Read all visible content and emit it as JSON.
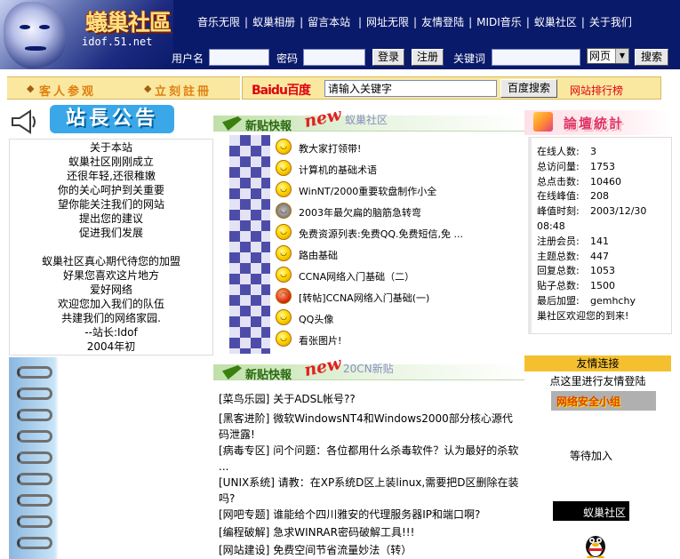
{
  "header": {
    "logo_text": "蟻巢社區",
    "logo_domain": "idof.51.net",
    "nav": [
      "音乐无限",
      "蚁巢相册",
      "留言本站",
      "网址无限",
      "友情登陆",
      "MIDI音乐",
      "蚁巢社区",
      "关于我们"
    ],
    "login": {
      "username_label": "用户名",
      "password_label": "密码",
      "login_button": "登录",
      "register_button": "注册",
      "keyword_label": "关键词",
      "search_scope": "网页",
      "search_button": "搜索"
    }
  },
  "band": {
    "guest_link": "客人参观",
    "register_link": "立刻註冊",
    "baidu_logo": "Baidu百度",
    "baidu_input_value": "请输入关键字",
    "baidu_button": "百度搜索",
    "rank_link": "网站排行榜"
  },
  "notice": {
    "title": "站長公告",
    "lines": [
      "关于本站",
      "蚁巢社区刚刚成立",
      "还很年轻,还很稚嫩",
      "你的关心呵护到关重要",
      "望你能关注我们的网站",
      "提出您的建议",
      "促进我们发展",
      "",
      "蚁巢社区真心期代待您的加盟",
      "好果您喜欢这片地方",
      "爱好网络",
      "欢迎您加入我们的队伍",
      "共建我们的网络家园.",
      "--站长:Idof",
      "2004年初"
    ]
  },
  "section1": {
    "title": "新贴快報",
    "badge": "new",
    "subtitle": "蚁巢社区",
    "posts": [
      "教大家打领带!",
      "计算机的基础术语",
      "WinNT/2000重要软盘制作小全",
      "2003年最欠扁的脑筋急转弯",
      "免费资源列表:免费QQ.免费短信,免 ...",
      "路由基础",
      "CCNA网络入门基础（二）",
      "[转帖]CCNA网络入门基础(一)",
      "QQ头像",
      "看张图片!"
    ]
  },
  "section2": {
    "title": "新贴快報",
    "badge": "new",
    "subtitle": "20CN新贴",
    "items": [
      {
        "tag": "[菜鸟乐园]",
        "text": "关于ADSL帐号??"
      },
      {
        "tag": "[黑客进阶]",
        "text": "微软WindowsNT4和Windows2000部分核心源代码泄露!"
      },
      {
        "tag": "[病毒专区]",
        "text": "问个问题：各位都用什么杀毒软件？认为最好的杀软 ..."
      },
      {
        "tag": "[UNIX系统]",
        "text": "请教：在XP系统D区上装linux,需要把D区删除在装吗?"
      },
      {
        "tag": "[网吧专题]",
        "text": "谁能给个四川雅安的代理服务器IP和端口啊?"
      },
      {
        "tag": "[编程破解]",
        "text": "急求WINRAR密码破解工具!!!"
      },
      {
        "tag": "[网站建设]",
        "text": "免费空间节省流量妙法（转）"
      }
    ]
  },
  "stats": {
    "title": "論壇統計",
    "rows": [
      {
        "k": "在线人数:",
        "v": "3"
      },
      {
        "k": "总访问量:",
        "v": "1753"
      },
      {
        "k": "总点击数:",
        "v": "10460"
      },
      {
        "k": "在线峰值:",
        "v": "208"
      },
      {
        "k": "峰值时刻:",
        "v": "2003/12/30"
      },
      {
        "k": "08:48",
        "v": ""
      },
      {
        "k": "注册会员:",
        "v": "141"
      },
      {
        "k": "主题总数:",
        "v": "447"
      },
      {
        "k": "回复总数:",
        "v": "1053"
      },
      {
        "k": "贴子总数:",
        "v": "1500"
      },
      {
        "k": "最后加盟:",
        "v": "gemhchy"
      },
      {
        "k": "巢社区欢迎您的到来!",
        "v": ""
      }
    ]
  },
  "friends": {
    "title": "友情连接",
    "subtitle": "点这里进行友情登陆",
    "banner1": "网络安全小组",
    "waiting": "等待加入",
    "banner2": "蚁巢社区"
  },
  "colors": {
    "header_bg": "#0a1a6a",
    "band_bg": "#fae8a0",
    "accent_red": "#e00010"
  }
}
